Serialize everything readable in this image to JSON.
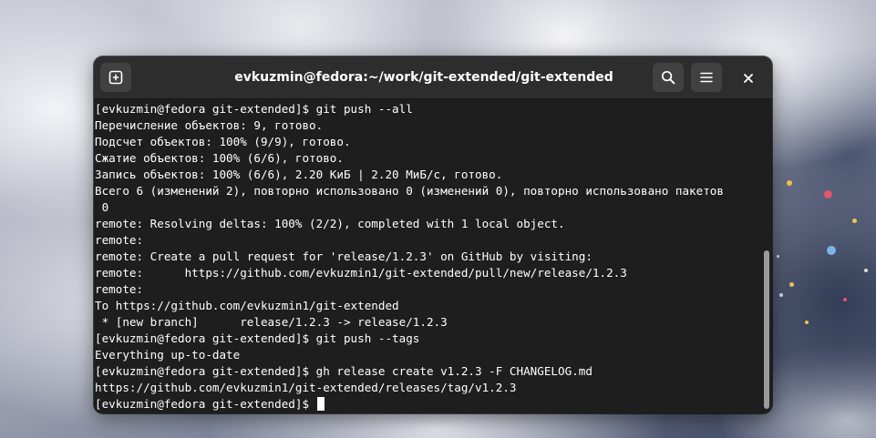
{
  "window": {
    "title": "evkuzmin@fedora:~/work/git-extended/git-extended"
  },
  "headerbar": {
    "new_tab_icon": "new-tab-icon",
    "search_icon": "search-icon",
    "menu_icon": "hamburger-menu-icon",
    "close_icon": "close-icon"
  },
  "terminal": {
    "lines": [
      "[evkuzmin@fedora git-extended]$ git push --all",
      "Перечисление объектов: 9, готово.",
      "Подсчет объектов: 100% (9/9), готово.",
      "Сжатие объектов: 100% (6/6), готово.",
      "Запись объектов: 100% (6/6), 2.20 КиБ | 2.20 МиБ/с, готово.",
      "Всего 6 (изменений 2), повторно использовано 0 (изменений 0), повторно использовано пакетов",
      " 0",
      "remote: Resolving deltas: 100% (2/2), completed with 1 local object.",
      "remote:",
      "remote: Create a pull request for 'release/1.2.3' on GitHub by visiting:",
      "remote:      https://github.com/evkuzmin1/git-extended/pull/new/release/1.2.3",
      "remote:",
      "To https://github.com/evkuzmin1/git-extended",
      " * [new branch]      release/1.2.3 -> release/1.2.3",
      "[evkuzmin@fedora git-extended]$ git push --tags",
      "Everything up-to-date",
      "[evkuzmin@fedora git-extended]$ gh release create v1.2.3 -F CHANGELOG.md",
      "https://github.com/evkuzmin1/git-extended/releases/tag/v1.2.3"
    ],
    "prompt": "[evkuzmin@fedora git-extended]$ "
  },
  "colors": {
    "terminal_bg": "#1e1e1e",
    "headerbar_bg": "#2d2d2d",
    "text": "#ffffff",
    "button_bg": "#414141"
  }
}
